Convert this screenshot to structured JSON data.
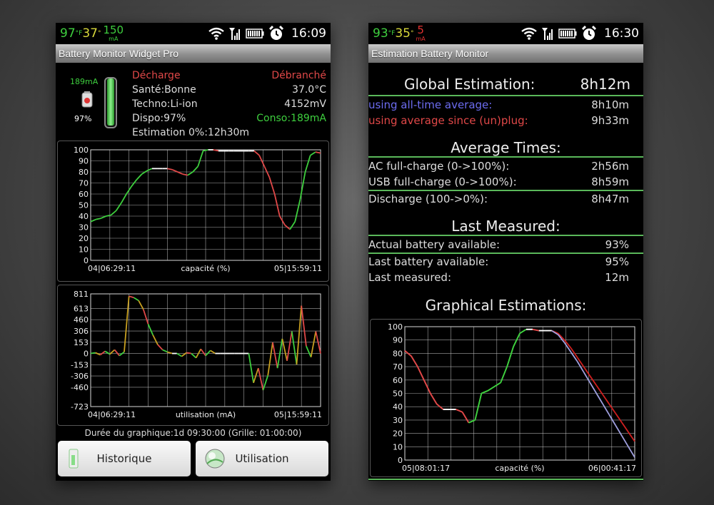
{
  "left": {
    "status": {
      "temp_f": "97",
      "temp_f_unit": "°F",
      "temp_c": "37",
      "temp_c_unit": "°",
      "current": "150",
      "current_unit": "mA",
      "time": "16:09"
    },
    "title": "Battery Monitor Widget Pro",
    "battery": {
      "current": "189mA",
      "percent": "97%",
      "level": 0.97
    },
    "info_left": [
      "Décharge",
      "Santé:Bonne",
      "Techno:Li-ion",
      "Dispo:97%",
      "Estimation 0%:12h30m"
    ],
    "info_right": [
      "Débranché",
      "37.0°C",
      "4152mV",
      "Conso:189mA"
    ],
    "chart1": {
      "y_ticks": [
        "100",
        "90",
        "80",
        "70",
        "60",
        "50",
        "40",
        "30",
        "20",
        "10",
        "0"
      ],
      "x_start": "04|06:29:11",
      "x_label": "capacité (%)",
      "x_end": "05|15:59:11"
    },
    "chart2": {
      "y_ticks": [
        "811",
        "613",
        "460",
        "306",
        "153",
        "0",
        "-153",
        "-306",
        "-460",
        "-723"
      ],
      "x_start": "04|06:29:11",
      "x_label": "utilisation (mA)",
      "x_end": "05|15:59:11"
    },
    "duration": "Durée du graphique:1d 09:30:00 (Grille: 01:00:00)",
    "buttons": {
      "historique": "Historique",
      "utilisation": "Utilisation"
    }
  },
  "right": {
    "status": {
      "temp_f": "93",
      "temp_f_unit": "°F",
      "temp_c": "35",
      "temp_c_unit": "°",
      "current": "5",
      "current_unit": "mA",
      "time": "16:30"
    },
    "title": "Estimation Battery Monitor",
    "global": {
      "heading": "Global Estimation:",
      "value": "8h12m",
      "rows": [
        {
          "label": "using all-time average:",
          "value": "8h10m"
        },
        {
          "label": "using average since (un)plug:",
          "value": "9h33m"
        }
      ]
    },
    "average": {
      "heading": "Average Times:",
      "rows": [
        {
          "label": "AC full-charge (0->100%):",
          "value": "2h56m"
        },
        {
          "label": "USB full-charge (0->100%):",
          "value": "8h59m"
        },
        {
          "label": "Discharge (100->0%):",
          "value": "8h47m"
        }
      ]
    },
    "last": {
      "heading": "Last Measured:",
      "rows": [
        {
          "label": "Actual battery available:",
          "value": "93%"
        },
        {
          "label": "Last battery available:",
          "value": "95%"
        },
        {
          "label": "Last measured:",
          "value": "12m"
        }
      ]
    },
    "graph_heading": "Graphical Estimations:",
    "chart3": {
      "y_ticks": [
        "100",
        "90",
        "80",
        "70",
        "60",
        "50",
        "40",
        "30",
        "20",
        "10",
        "0"
      ],
      "x_start": "05|08:01:17",
      "x_label": "capacité (%)",
      "x_end": "06|00:41:17"
    }
  },
  "colors": {
    "green": "#3ecf3e",
    "red": "#e04848",
    "blue": "#6c6cf0",
    "grid": "#cfcfcf",
    "divider": "#5ab85a"
  },
  "chart_data": [
    {
      "type": "line",
      "ylabel": "",
      "xlabel": "capacité (%)",
      "ylim": [
        0,
        100
      ],
      "x_range": [
        "04|06:29:11",
        "05|15:59:11"
      ],
      "series": [
        {
          "values": [
            35,
            37,
            38,
            40,
            41,
            45,
            52,
            60,
            67,
            73,
            78,
            81,
            83,
            83,
            83,
            83,
            82,
            80,
            78,
            77,
            80,
            85,
            99,
            100,
            100,
            99,
            99,
            99,
            99,
            99,
            99,
            99,
            99,
            95,
            85,
            75,
            60,
            40,
            32,
            28,
            35,
            55,
            80,
            95,
            98,
            97
          ]
        }
      ]
    },
    {
      "type": "line",
      "ylabel": "",
      "xlabel": "utilisation (mA)",
      "ylim": [
        -723,
        811
      ],
      "x_range": [
        "04|06:29:11",
        "05|15:59:11"
      ],
      "series": [
        {
          "values": [
            0,
            10,
            -20,
            30,
            -10,
            50,
            -30,
            20,
            780,
            760,
            720,
            600,
            400,
            250,
            120,
            50,
            20,
            0,
            0,
            -40,
            10,
            0,
            -60,
            60,
            -30,
            40,
            0,
            0,
            0,
            0,
            0,
            0,
            0,
            0,
            -400,
            -200,
            -500,
            -300,
            150,
            -200,
            200,
            -100,
            300,
            -150,
            650,
            100,
            -50,
            300,
            0
          ]
        }
      ]
    },
    {
      "type": "line",
      "ylabel": "",
      "xlabel": "capacité (%)",
      "ylim": [
        0,
        100
      ],
      "x_range": [
        "05|08:01:17",
        "06|00:41:17"
      ],
      "series": [
        {
          "values": [
            82,
            78,
            70,
            60,
            50,
            42,
            38,
            38,
            38,
            36,
            28,
            30,
            50,
            52,
            55,
            58,
            70,
            85,
            95,
            98,
            98,
            97,
            97,
            97,
            95,
            90,
            84,
            77,
            70,
            63,
            56,
            49,
            42,
            35,
            28,
            21,
            14
          ]
        },
        {
          "values": [
            82,
            78,
            70,
            60,
            50,
            42,
            38,
            38,
            38,
            36,
            28,
            30,
            50,
            52,
            55,
            58,
            70,
            85,
            95,
            98,
            98,
            97,
            97,
            97,
            94,
            88,
            81,
            74,
            66,
            58,
            50,
            42,
            34,
            26,
            18,
            10,
            2
          ]
        }
      ]
    }
  ]
}
